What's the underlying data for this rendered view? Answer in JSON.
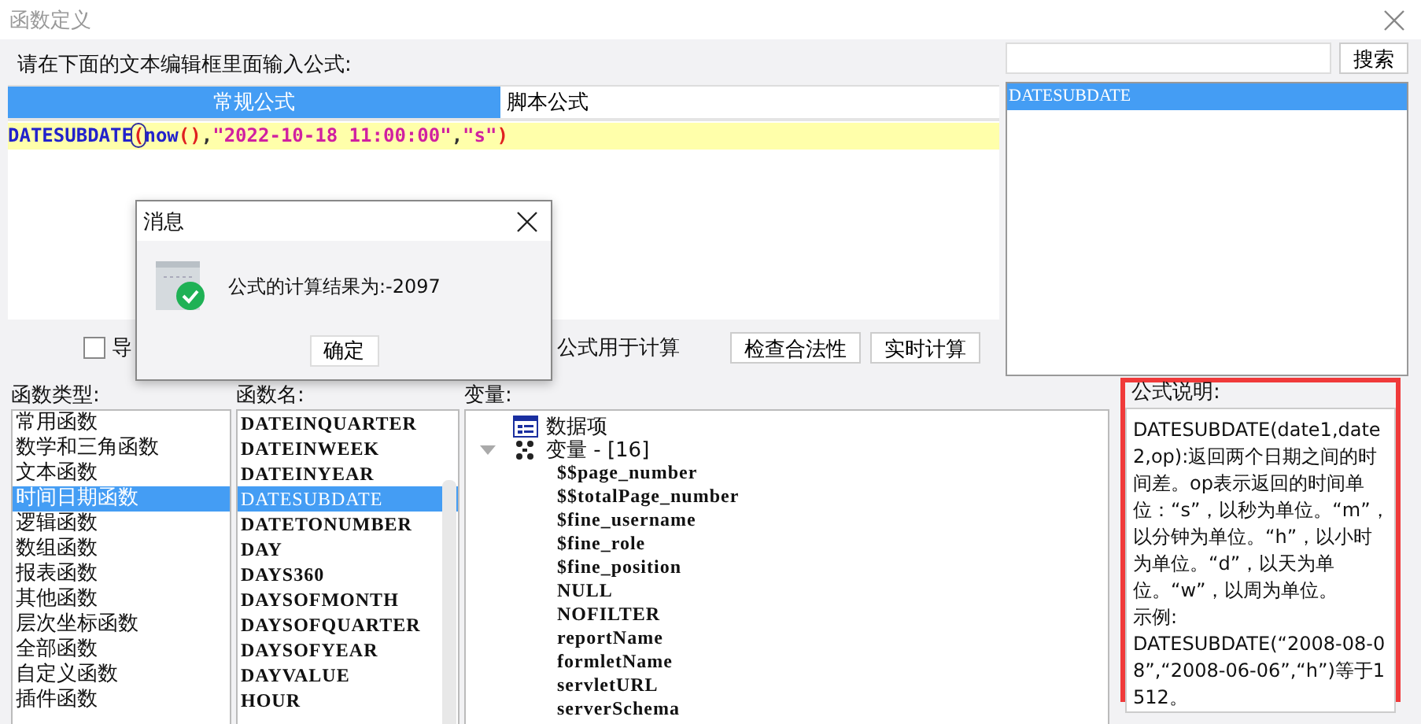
{
  "window": {
    "title": "函数定义"
  },
  "editor": {
    "prompt": "请在下面的文本编辑框里面输入公式:",
    "tabs": [
      {
        "label": "常规公式",
        "selected": true
      },
      {
        "label": "脚本公式",
        "selected": false
      }
    ],
    "formula": [
      {
        "kind": "function",
        "text": "DATESUBDATE"
      },
      {
        "kind": "paren",
        "text": "(",
        "matched": true
      },
      {
        "kind": "function",
        "text": "now"
      },
      {
        "kind": "paren",
        "text": "()",
        "matched": false
      },
      {
        "kind": "plain",
        "text": ","
      },
      {
        "kind": "string",
        "text": "\"2022-10-18 11:00:00\""
      },
      {
        "kind": "plain",
        "text": ","
      },
      {
        "kind": "string",
        "text": "\"s\""
      },
      {
        "kind": "paren",
        "text": ")",
        "matched": false
      }
    ]
  },
  "options": {
    "checkbox": {
      "label": "导",
      "checked": false
    },
    "note": "公式用于计算",
    "buttons": [
      "检查合法性",
      "实时计算"
    ]
  },
  "search": {
    "button": "搜索"
  },
  "results": [
    {
      "label": "DATESUBDATE",
      "selected": true
    }
  ],
  "function_types": {
    "label": "函数类型:",
    "items": [
      {
        "label": "常用函数",
        "selected": false
      },
      {
        "label": "数学和三角函数",
        "selected": false
      },
      {
        "label": "文本函数",
        "selected": false
      },
      {
        "label": "时间日期函数",
        "selected": true
      },
      {
        "label": "逻辑函数",
        "selected": false
      },
      {
        "label": "数组函数",
        "selected": false
      },
      {
        "label": "报表函数",
        "selected": false
      },
      {
        "label": "其他函数",
        "selected": false
      },
      {
        "label": "层次坐标函数",
        "selected": false
      },
      {
        "label": "全部函数",
        "selected": false
      },
      {
        "label": "自定义函数",
        "selected": false
      },
      {
        "label": "插件函数",
        "selected": false
      }
    ]
  },
  "function_names": {
    "label": "函数名:",
    "items": [
      {
        "label": "DATEINQUARTER",
        "selected": false
      },
      {
        "label": "DATEINWEEK",
        "selected": false
      },
      {
        "label": "DATEINYEAR",
        "selected": false
      },
      {
        "label": "DATESUBDATE",
        "selected": true
      },
      {
        "label": "DATETONUMBER",
        "selected": false
      },
      {
        "label": "DAY",
        "selected": false
      },
      {
        "label": "DAYS360",
        "selected": false
      },
      {
        "label": "DAYSOFMONTH",
        "selected": false
      },
      {
        "label": "DAYSOFQUARTER",
        "selected": false
      },
      {
        "label": "DAYSOFYEAR",
        "selected": false
      },
      {
        "label": "DAYVALUE",
        "selected": false
      },
      {
        "label": "HOUR",
        "selected": false
      }
    ]
  },
  "variables": {
    "label": "变量:",
    "tree": [
      {
        "kind": "dataset",
        "label": "数据项"
      },
      {
        "kind": "variables",
        "label": "变量 - [16]",
        "expanded": true,
        "children": [
          {
            "label": "$$page_number"
          },
          {
            "label": "$$totalPage_number"
          },
          {
            "label": "$fine_username"
          },
          {
            "label": "$fine_role"
          },
          {
            "label": "$fine_position"
          },
          {
            "label": "NULL"
          },
          {
            "label": "NOFILTER"
          },
          {
            "label": "reportName"
          },
          {
            "label": "formletName"
          },
          {
            "label": "servletURL"
          },
          {
            "label": "serverSchema"
          }
        ]
      }
    ]
  },
  "description": {
    "label": "公式说明:",
    "paragraphs": [
      "DATESUBDATE(date1,date2,op):返回两个日期之间的时间差。op表示返回的时间单位：“s”，以秒为单位。“m”，以分钟为单位。“h”，以小时为单位。“d”，以天为单位。“w”，以周为单位。",
      "示例:",
      "DATESUBDATE(“2008-08-08”,“2008-06-06”,“h”)等于1512。"
    ]
  },
  "message": {
    "title": "消息",
    "text": "公式的计算结果为:-2097",
    "button": "确定"
  }
}
